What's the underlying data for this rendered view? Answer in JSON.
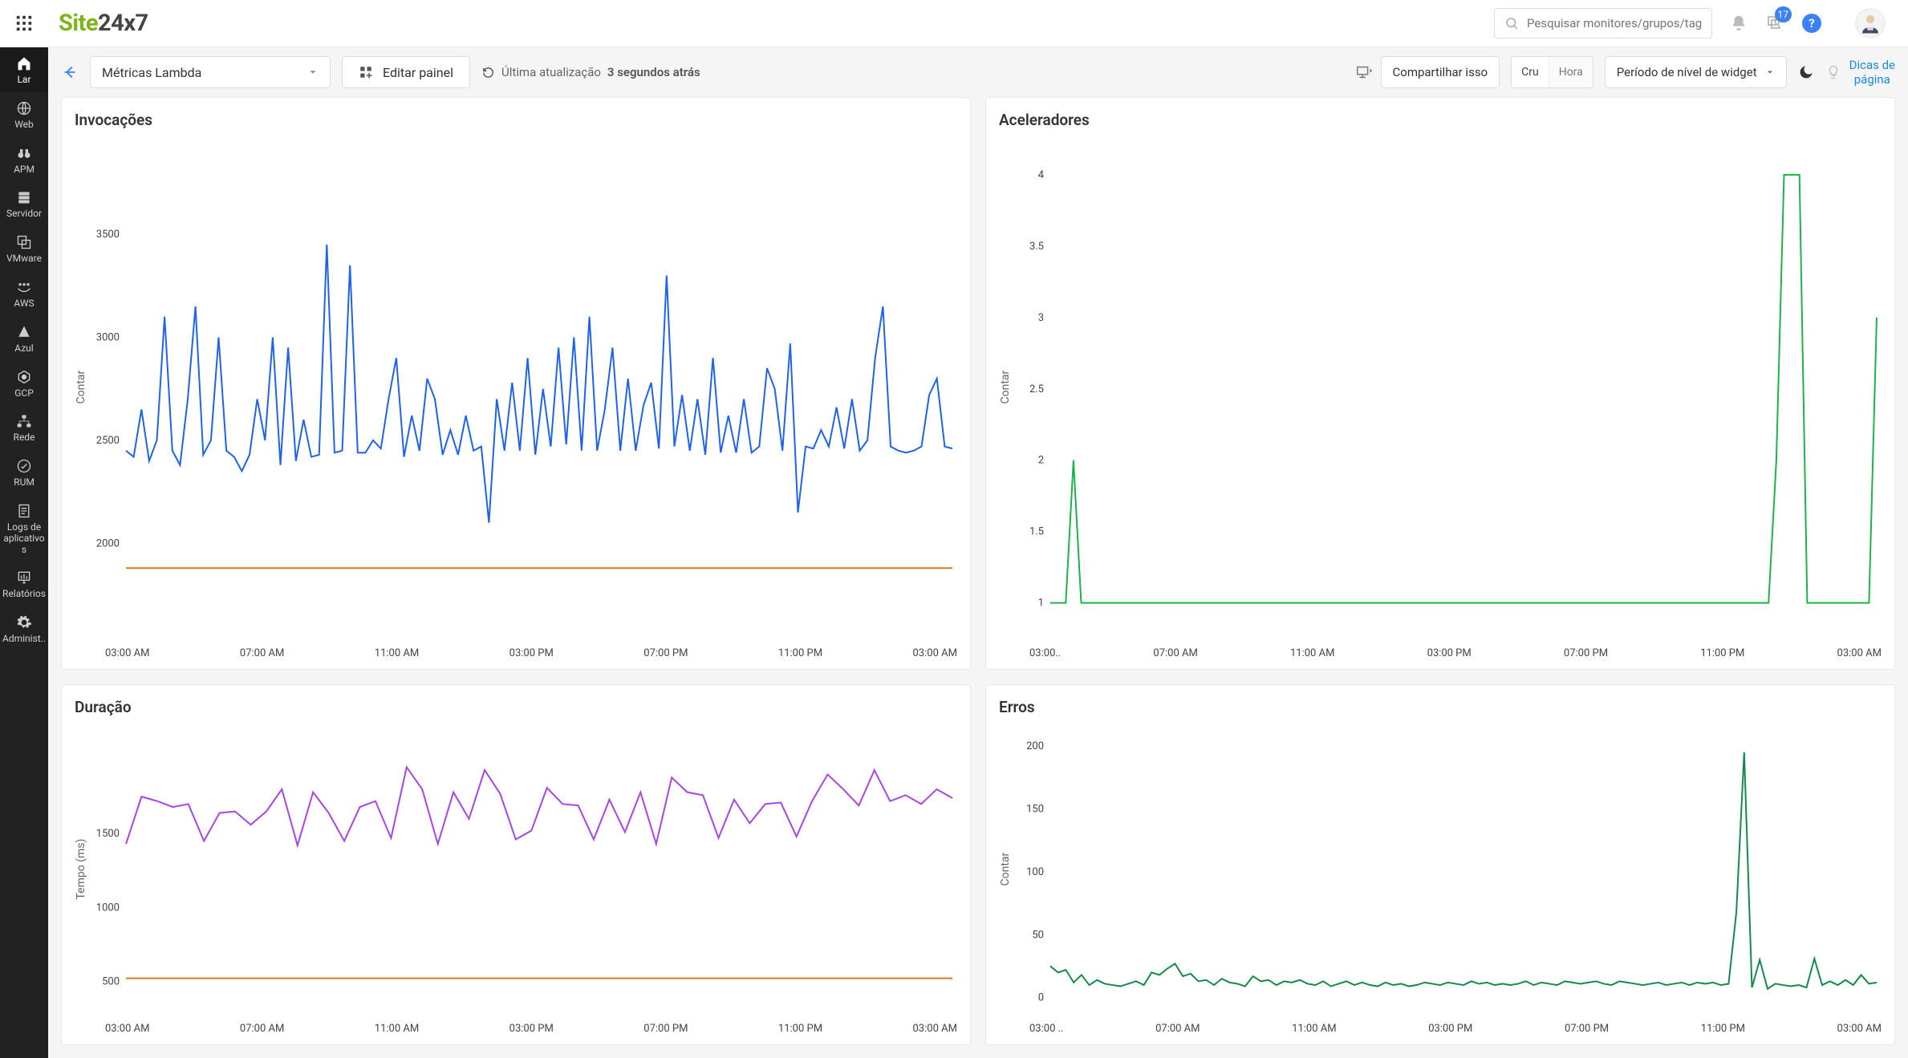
{
  "brand": {
    "site": "Site",
    "suffix": "24x7"
  },
  "search": {
    "placeholder": "Pesquisar monitores/grupos/tags"
  },
  "notifications_badge": "17",
  "sidebar": {
    "items": [
      {
        "label": "Lar"
      },
      {
        "label": "Web"
      },
      {
        "label": "APM"
      },
      {
        "label": "Servidor"
      },
      {
        "label": "VMware"
      },
      {
        "label": "AWS"
      },
      {
        "label": "Azul"
      },
      {
        "label": "GCP"
      },
      {
        "label": "Rede"
      },
      {
        "label": "RUM"
      },
      {
        "label": "Logs de aplicativos"
      },
      {
        "label": "Relatórios"
      },
      {
        "label": "Administ.."
      }
    ]
  },
  "toolbar": {
    "dashboard_select": "Métricas Lambda",
    "edit_panel": "Editar painel",
    "last_update_label": "Última atualização",
    "last_update_value": "3 segundos atrás",
    "share": "Compartilhar isso",
    "seg_raw": "Cru",
    "seg_hour": "Hora",
    "level_select": "Período de nível de widget",
    "tips_line1": "Dicas de",
    "tips_line2": "página"
  },
  "chart_data": [
    {
      "title": "Invocações",
      "type": "line",
      "ylabel": "Contar",
      "ylim": [
        1800,
        3700
      ],
      "yticks": [
        2000,
        2500,
        3000,
        3500
      ],
      "xticks": [
        "03:00 AM",
        "07:00 AM",
        "11:00 AM",
        "03:00 PM",
        "07:00 PM",
        "11:00 PM",
        "03:00 AM"
      ],
      "colors": {
        "primary": "#1e63e9",
        "baseline": "#d97a1a"
      },
      "series": [
        {
          "name": "invocations",
          "color": "#1e63e9",
          "values": [
            2450,
            2420,
            2650,
            2400,
            2500,
            3100,
            2450,
            2380,
            2700,
            3150,
            2430,
            2500,
            3000,
            2450,
            2420,
            2350,
            2430,
            2700,
            2500,
            3000,
            2380,
            2950,
            2400,
            2600,
            2420,
            2430,
            3450,
            2440,
            2450,
            3350,
            2440,
            2440,
            2500,
            2460,
            2700,
            2900,
            2420,
            2620,
            2450,
            2800,
            2700,
            2430,
            2550,
            2430,
            2620,
            2450,
            2470,
            2100,
            2700,
            2450,
            2780,
            2450,
            2900,
            2430,
            2750,
            2470,
            2950,
            2480,
            3000,
            2450,
            3100,
            2450,
            2650,
            2950,
            2450,
            2800,
            2450,
            2670,
            2780,
            2460,
            3300,
            2470,
            2720,
            2450,
            2700,
            2430,
            2900,
            2440,
            2620,
            2440,
            2700,
            2440,
            2470,
            2850,
            2750,
            2450,
            2970,
            2150,
            2470,
            2460,
            2550,
            2470,
            2660,
            2460,
            2700,
            2450,
            2500,
            2900,
            3150,
            2470,
            2450,
            2440,
            2450,
            2470,
            2720,
            2800,
            2470,
            2460
          ]
        },
        {
          "name": "baseline",
          "color": "#d97a1a",
          "values": [
            1880,
            1880,
            1880,
            1880,
            1880,
            1880,
            1880,
            1880,
            1880,
            1880,
            1880,
            1880,
            1880,
            1880,
            1880,
            1880,
            1880,
            1880,
            1880,
            1880,
            1880,
            1880,
            1880,
            1880,
            1880,
            1880,
            1880,
            1880,
            1880,
            1880,
            1880,
            1880,
            1880,
            1880,
            1880,
            1880,
            1880,
            1880,
            1880,
            1880,
            1880,
            1880,
            1880,
            1880,
            1880,
            1880,
            1880,
            1880,
            1880,
            1880,
            1880,
            1880,
            1880,
            1880,
            1880,
            1880,
            1880,
            1880,
            1880,
            1880,
            1880,
            1880,
            1880,
            1880,
            1880,
            1880,
            1880,
            1880,
            1880,
            1880,
            1880,
            1880,
            1880,
            1880,
            1880,
            1880,
            1880,
            1880,
            1880,
            1880,
            1880,
            1880,
            1880,
            1880,
            1880,
            1880,
            1880,
            1880,
            1880,
            1880,
            1880,
            1880,
            1880,
            1880,
            1880,
            1880,
            1880,
            1880,
            1880,
            1880,
            1880,
            1880,
            1880,
            1880,
            1880,
            1880,
            1880,
            1880
          ]
        }
      ]
    },
    {
      "title": "Aceleradores",
      "type": "line",
      "ylabel": "Contar",
      "ylim": [
        0.8,
        4.2
      ],
      "yticks": [
        1,
        1.5,
        2,
        2.5,
        3,
        3.5,
        4
      ],
      "xticks": [
        "03:00..",
        "07:00 AM",
        "11:00 AM",
        "03:00 PM",
        "07:00 PM",
        "11:00 PM",
        "03:00 AM"
      ],
      "colors": {
        "primary": "#1cb34a"
      },
      "series": [
        {
          "name": "throttles",
          "color": "#1cb34a",
          "values": [
            1,
            1,
            1,
            2,
            1,
            1,
            1,
            1,
            1,
            1,
            1,
            1,
            1,
            1,
            1,
            1,
            1,
            1,
            1,
            1,
            1,
            1,
            1,
            1,
            1,
            1,
            1,
            1,
            1,
            1,
            1,
            1,
            1,
            1,
            1,
            1,
            1,
            1,
            1,
            1,
            1,
            1,
            1,
            1,
            1,
            1,
            1,
            1,
            1,
            1,
            1,
            1,
            1,
            1,
            1,
            1,
            1,
            1,
            1,
            1,
            1,
            1,
            1,
            1,
            1,
            1,
            1,
            1,
            1,
            1,
            1,
            1,
            1,
            1,
            1,
            1,
            1,
            1,
            1,
            1,
            1,
            1,
            1,
            1,
            1,
            1,
            1,
            1,
            1,
            1,
            1,
            1,
            1,
            1,
            2,
            4,
            4,
            4,
            1,
            1,
            1,
            1,
            1,
            1,
            1,
            1,
            1,
            3
          ]
        }
      ]
    },
    {
      "title": "Duração",
      "type": "line",
      "ylabel": "Tempo (ms)",
      "ylim": [
        400,
        2100
      ],
      "yticks": [
        500,
        1000,
        1500
      ],
      "xticks": [
        "03:00 AM",
        "07:00 AM",
        "11:00 AM",
        "03:00 PM",
        "07:00 PM",
        "11:00 PM",
        "03:00 AM"
      ],
      "colors": {
        "primary": "#a646e6",
        "baseline": "#d97a1a"
      },
      "series": [
        {
          "name": "duration",
          "color": "#a646e6",
          "values": [
            1430,
            1750,
            1720,
            1680,
            1700,
            1450,
            1640,
            1650,
            1560,
            1650,
            1800,
            1420,
            1780,
            1640,
            1450,
            1680,
            1720,
            1470,
            1950,
            1800,
            1430,
            1780,
            1600,
            1930,
            1770,
            1460,
            1520,
            1810,
            1700,
            1690,
            1460,
            1730,
            1510,
            1780,
            1430,
            1880,
            1780,
            1760,
            1470,
            1730,
            1570,
            1700,
            1710,
            1480,
            1720,
            1900,
            1800,
            1690,
            1930,
            1720,
            1760,
            1700,
            1800,
            1740
          ]
        },
        {
          "name": "baseline",
          "color": "#d97a1a",
          "values": [
            520,
            520,
            520,
            520,
            520,
            520,
            520,
            520,
            520,
            520,
            520,
            520,
            520,
            520,
            520,
            520,
            520,
            520,
            520,
            520,
            520,
            520,
            520,
            520,
            520,
            520,
            520,
            520,
            520,
            520,
            520,
            520,
            520,
            520,
            520,
            520,
            520,
            520,
            520,
            520,
            520,
            520,
            520,
            520,
            520,
            520,
            520,
            520,
            520,
            520,
            520,
            520,
            520,
            520
          ]
        }
      ]
    },
    {
      "title": "Erros",
      "type": "line",
      "ylabel": "Contar",
      "ylim": [
        -8,
        210
      ],
      "yticks": [
        0,
        50,
        100,
        150,
        200
      ],
      "xticks": [
        "03:00 ..",
        "07:00 AM",
        "11:00 AM",
        "03:00 PM",
        "07:00 PM",
        "11:00 PM",
        "03:00 AM"
      ],
      "colors": {
        "primary": "#148a4a"
      },
      "series": [
        {
          "name": "errors",
          "color": "#148a4a",
          "values": [
            25,
            20,
            22,
            12,
            18,
            10,
            14,
            11,
            10,
            9,
            11,
            13,
            10,
            20,
            18,
            23,
            27,
            17,
            19,
            13,
            14,
            10,
            15,
            12,
            11,
            9,
            17,
            13,
            14,
            10,
            13,
            12,
            14,
            11,
            10,
            13,
            9,
            11,
            13,
            10,
            12,
            10,
            9,
            12,
            10,
            11,
            9,
            10,
            12,
            11,
            10,
            12,
            11,
            10,
            13,
            11,
            12,
            10,
            11,
            10,
            11,
            13,
            10,
            12,
            11,
            10,
            13,
            12,
            11,
            12,
            13,
            11,
            10,
            13,
            12,
            11,
            10,
            11,
            12,
            10,
            11,
            12,
            10,
            12,
            11,
            12,
            10,
            11,
            68,
            195,
            8,
            30,
            7,
            11,
            10,
            9,
            10,
            8,
            31,
            10,
            13,
            10,
            14,
            10,
            18,
            11,
            12
          ]
        }
      ]
    }
  ]
}
